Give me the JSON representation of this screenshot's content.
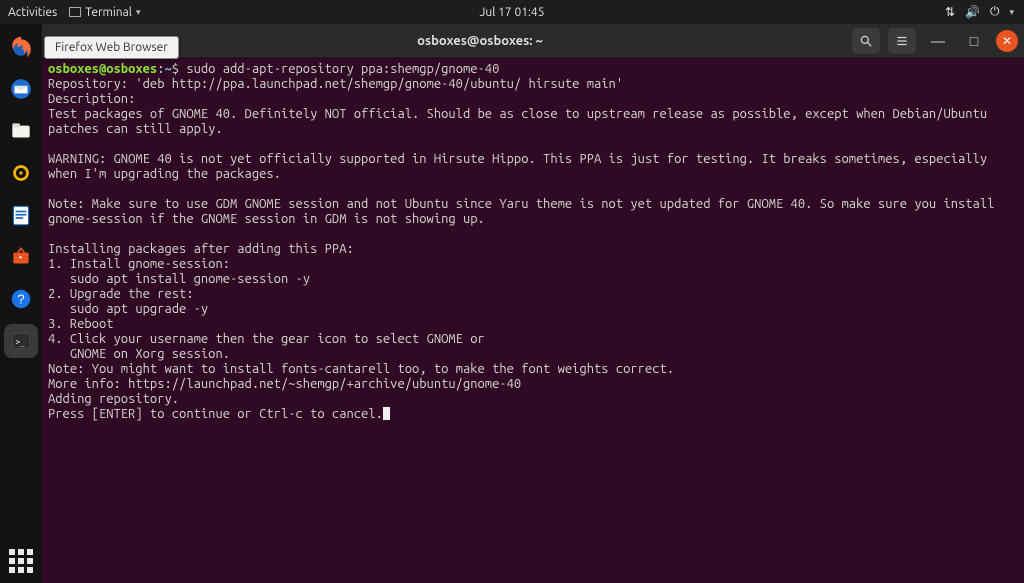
{
  "panel": {
    "activities": "Activities",
    "app_menu": "Terminal",
    "clock": "Jul 17  01:45"
  },
  "status_icons": [
    "network-icon",
    "volume-icon",
    "power-icon",
    "chevron-down-icon"
  ],
  "tooltip": {
    "text": "Firefox Web Browser"
  },
  "dock": {
    "items": [
      {
        "name": "firefox-icon"
      },
      {
        "name": "thunderbird-icon"
      },
      {
        "name": "files-icon"
      },
      {
        "name": "rhythmbox-icon"
      },
      {
        "name": "libreoffice-writer-icon"
      },
      {
        "name": "ubuntu-software-icon"
      },
      {
        "name": "help-icon"
      },
      {
        "name": "terminal-icon"
      }
    ],
    "apps_button": "show-applications-icon"
  },
  "window": {
    "title": "osboxes@osboxes: ~",
    "search_icon": "search-icon",
    "menu_icon": "hamburger-icon",
    "minimize_icon": "minimize-icon",
    "maximize_icon": "maximize-icon",
    "close_icon": "close-icon"
  },
  "terminal": {
    "prompt_user": "osboxes@osboxes",
    "prompt_sep": ":",
    "prompt_path": "~",
    "prompt_end": "$ ",
    "command": "sudo add-apt-repository ppa:shemgp/gnome-40",
    "lines": [
      "Repository: 'deb http://ppa.launchpad.net/shemgp/gnome-40/ubuntu/ hirsute main'",
      "Description:",
      "Test packages of GNOME 40. Definitely NOT official. Should be as close to upstream release as possible, except when Debian/Ubuntu patches can still apply.",
      "",
      "WARNING: GNOME 40 is not yet officially supported in Hirsute Hippo. This PPA is just for testing. It breaks sometimes, especially when I'm upgrading the packages.",
      "",
      "Note: Make sure to use GDM GNOME session and not Ubuntu since Yaru theme is not yet updated for GNOME 40. So make sure you install gnome-session if the GNOME session in GDM is not showing up.",
      "",
      "Installing packages after adding this PPA:",
      "1. Install gnome-session:",
      "   sudo apt install gnome-session -y",
      "2. Upgrade the rest:",
      "   sudo apt upgrade -y",
      "3. Reboot",
      "4. Click your username then the gear icon to select GNOME or",
      "   GNOME on Xorg session.",
      "Note: You might want to install fonts-cantarell too, to make the font weights correct.",
      "More info: https://launchpad.net/~shemgp/+archive/ubuntu/gnome-40",
      "Adding repository.",
      "Press [ENTER] to continue or Ctrl-c to cancel."
    ]
  }
}
